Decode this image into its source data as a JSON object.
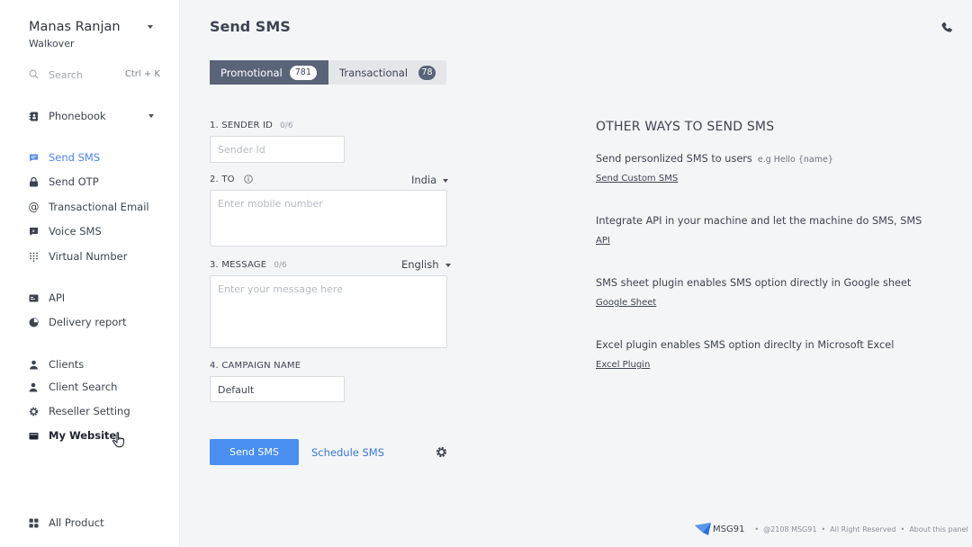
{
  "user": {
    "name": "Manas Ranjan",
    "org": "Walkover"
  },
  "search": {
    "label": "Search",
    "shortcut": "Ctrl + K"
  },
  "sidebar": {
    "phonebook": "Phonebook",
    "items": [
      {
        "label": "Send SMS",
        "icon": "sms-icon"
      },
      {
        "label": "Send OTP",
        "icon": "otp-icon"
      },
      {
        "label": "Transactional Email",
        "icon": "at-icon"
      },
      {
        "label": "Voice SMS",
        "icon": "voice-icon"
      },
      {
        "label": "Virtual Number",
        "icon": "dialpad-icon"
      },
      {
        "label": "API",
        "icon": "api-icon"
      },
      {
        "label": "Delivery report",
        "icon": "pie-icon"
      },
      {
        "label": "Clients",
        "icon": "clients-icon"
      },
      {
        "label": "Client Search",
        "icon": "user-search-icon"
      },
      {
        "label": "Reseller Setting",
        "icon": "gear-icon"
      },
      {
        "label": "My Website",
        "icon": "website-icon"
      },
      {
        "label": "All Product",
        "icon": "grid-icon"
      }
    ]
  },
  "page": {
    "title": "Send SMS"
  },
  "tabs": [
    {
      "label": "Promotional",
      "count": "781"
    },
    {
      "label": "Transactional",
      "count": "78"
    }
  ],
  "form": {
    "sender": {
      "label": "1.  SENDER ID",
      "counter": "0/6",
      "placeholder": "Sender Id"
    },
    "to": {
      "label": "2.  TO",
      "country": "India",
      "placeholder": "Enter mobile number"
    },
    "message": {
      "label": "3.  MESSAGE",
      "counter": "0/6",
      "language": "English",
      "placeholder": "Enter your message here"
    },
    "campaign": {
      "label": "4.  CAMPAIGN NAME",
      "value": "Default"
    },
    "send_button": "Send SMS",
    "schedule_link": "Schedule SMS"
  },
  "other_ways": {
    "title": "OTHER WAYS TO SEND SMS",
    "items": [
      {
        "desc": "Send personlized SMS to users",
        "example": "e.g Hello {name}",
        "link": "Send Custom SMS "
      },
      {
        "desc": "Integrate API in your machine and let the machine do SMS, SMS",
        "link": "API"
      },
      {
        "desc": "SMS sheet plugin enables SMS option directly in Google sheet",
        "link": "Google Sheet"
      },
      {
        "desc": "Excel plugin enables SMS option direclty in Microsoft Excel",
        "link": "Excel Plugin "
      }
    ]
  },
  "footer": {
    "logo": "MSG91",
    "copyright": "@2108 MSG91",
    "rights": "All Right Reserved",
    "about": "About this panel"
  },
  "colors": {
    "accent": "#4a8ef0",
    "active_nav": "#4a86e8",
    "tab_dark": "#5a6478"
  }
}
